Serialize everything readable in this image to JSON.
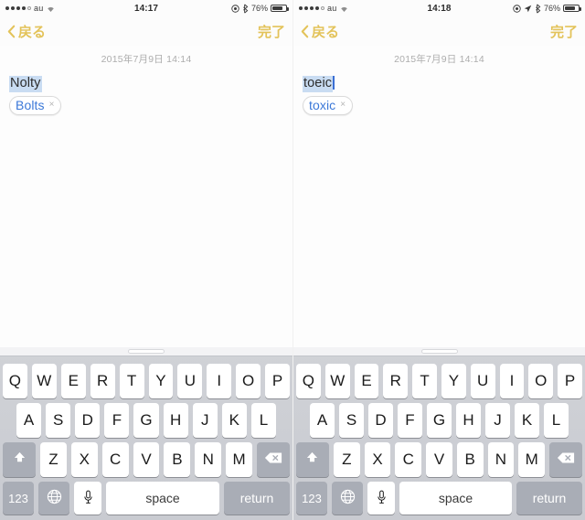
{
  "screens": [
    {
      "id": "left",
      "status": {
        "carrier": "au",
        "signal_dots_filled": 4,
        "signal_dots_total": 5,
        "wifi_icon": "wifi-icon",
        "time": "14:17",
        "icons": [
          "rotation-lock-icon",
          "bluetooth-icon"
        ],
        "battery_percent": "76%",
        "battery_level": 76
      },
      "nav": {
        "back_label": "戻る",
        "back_icon": "chevron-left-icon",
        "done_label": "完了"
      },
      "note": {
        "date": "2015年7月9日 14:14",
        "typed_text": "Nolty",
        "show_caret": false,
        "suggestion": "Bolts",
        "suggestion_dismiss": "×"
      }
    },
    {
      "id": "right",
      "status": {
        "carrier": "au",
        "signal_dots_filled": 4,
        "signal_dots_total": 5,
        "wifi_icon": "wifi-icon",
        "time": "14:18",
        "icons": [
          "rotation-lock-icon",
          "location-arrow-icon",
          "bluetooth-icon"
        ],
        "battery_percent": "76%",
        "battery_level": 76
      },
      "nav": {
        "back_label": "戻る",
        "back_icon": "chevron-left-icon",
        "done_label": "完了"
      },
      "note": {
        "date": "2015年7月9日 14:14",
        "typed_text": "toeic",
        "show_caret": true,
        "suggestion": "toxic",
        "suggestion_dismiss": "×"
      }
    }
  ],
  "keyboard": {
    "row1": [
      "Q",
      "W",
      "E",
      "R",
      "T",
      "Y",
      "U",
      "I",
      "O",
      "P"
    ],
    "row2": [
      "A",
      "S",
      "D",
      "F",
      "G",
      "H",
      "J",
      "K",
      "L"
    ],
    "row3": [
      "Z",
      "X",
      "C",
      "V",
      "B",
      "N",
      "M"
    ],
    "shift_icon": "shift-arrow-icon",
    "backspace_icon": "backspace-icon",
    "numeric_label": "123",
    "globe_icon": "globe-icon",
    "mic_icon": "microphone-icon",
    "space_label": "space",
    "return_label": "return"
  },
  "colors": {
    "accent": "#e3c35a",
    "suggestion_text": "#3b78d8",
    "selection_highlight": "#c9dcf2",
    "keyboard_bg": "#cbcdd3"
  }
}
